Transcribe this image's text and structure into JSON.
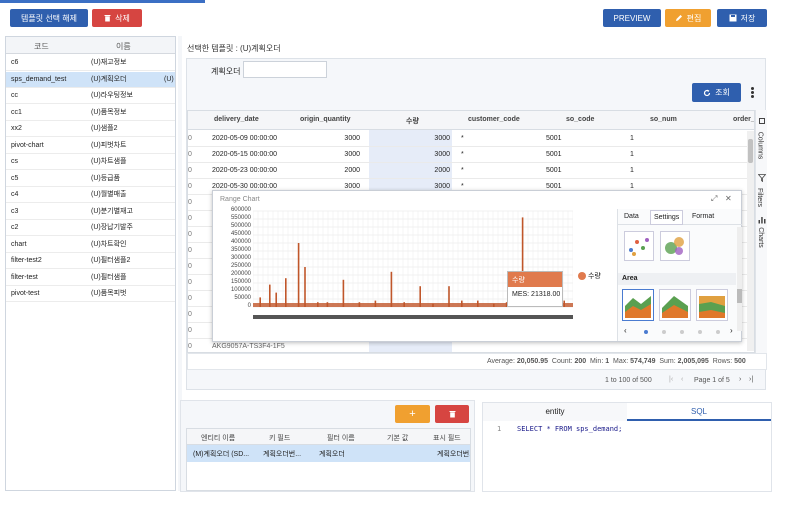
{
  "toolbar": {
    "deselect_label": "템플릿 선택 해제",
    "delete_label": "삭제",
    "preview_label": "PREVIEW",
    "edit_label": "편집",
    "save_label": "저장"
  },
  "colors": {
    "primary": "#2f5fae",
    "danger": "#d64541",
    "warning": "#f0a030",
    "chart_series": "#c0562a",
    "selected_row": "#cfe3f8"
  },
  "template_list": {
    "headers": [
      "코드",
      "이름"
    ],
    "rows": [
      {
        "code": "c6",
        "name": "(U)재고정보"
      },
      {
        "code": "sps_demand_test",
        "name": "(U)계획오더",
        "extra": "(U)"
      },
      {
        "code": "cc",
        "name": "(U)라우팅정보"
      },
      {
        "code": "cc1",
        "name": "(U)품목정보"
      },
      {
        "code": "xx2",
        "name": "(U)샘플2"
      },
      {
        "code": "pivot-chart",
        "name": "(U)피벗차트"
      },
      {
        "code": "cs",
        "name": "(U)차트샘플"
      },
      {
        "code": "c5",
        "name": "(U)등급품"
      },
      {
        "code": "c4",
        "name": "(U)월별매출"
      },
      {
        "code": "c3",
        "name": "(U)분기별재고"
      },
      {
        "code": "c2",
        "name": "(U)장납기발주"
      },
      {
        "code": "chart",
        "name": "(U)차트확인"
      },
      {
        "code": "filter-test2",
        "name": "(U)필터샘플2"
      },
      {
        "code": "filter-test",
        "name": "(U)필터샘플"
      },
      {
        "code": "pivot-test",
        "name": "(U)품목피벗"
      }
    ]
  },
  "main": {
    "selected_template": "선택한 템플릿 : (U)계획오더",
    "filter_label": "계획오더",
    "filter_value": "",
    "search_label": "조회"
  },
  "grid": {
    "headers": [
      "delivery_date",
      "origin_quantity",
      "수량",
      "customer_code",
      "so_code",
      "so_num",
      "order_"
    ],
    "rows": [
      [
        "2020-05-09 00:00:00",
        "3000",
        "3000",
        "*",
        "5001",
        "1"
      ],
      [
        "2020-05-15 00:00:00",
        "3000",
        "3000",
        "*",
        "5001",
        "1"
      ],
      [
        "2020-05-23 00:00:00",
        "2000",
        "2000",
        "*",
        "5001",
        "1"
      ],
      [
        "2020-05-30 00:00:00",
        "3000",
        "3000",
        "*",
        "5001",
        "1"
      ]
    ],
    "partial_row": "AKG9057A-TS3F4-1F5",
    "status": {
      "average_label": "Average:",
      "average": "20,050.95",
      "count_label": "Count:",
      "count": "200",
      "min_label": "Min:",
      "min": "1",
      "max_label": "Max:",
      "max": "574,749",
      "sum_label": "Sum:",
      "sum": "2,005,095",
      "rows_label": "Rows:",
      "rows": "500"
    },
    "pagination": {
      "range": "1 to 100 of 500",
      "page": "Page 1 of 5"
    },
    "side_tabs": [
      "Columns",
      "Filters",
      "Charts"
    ]
  },
  "range_chart": {
    "title": "Range Chart",
    "tooltip_title": "수량",
    "tooltip_value": "MES: 21318.00",
    "settings_tabs": [
      "Data",
      "Settings",
      "Format"
    ],
    "area_label": "Area"
  },
  "chart_data": {
    "type": "bar",
    "title": "",
    "xlabel": "",
    "ylabel": "",
    "ylim": [
      0,
      600000
    ],
    "yticks": [
      0,
      50000,
      100000,
      150000,
      200000,
      250000,
      300000,
      350000,
      400000,
      450000,
      500000,
      550000,
      600000
    ],
    "series": [
      {
        "name": "수량"
      }
    ],
    "spikes": [
      {
        "x": 0.02,
        "value": 60000
      },
      {
        "x": 0.05,
        "value": 140000
      },
      {
        "x": 0.07,
        "value": 90000
      },
      {
        "x": 0.1,
        "value": 180000
      },
      {
        "x": 0.14,
        "value": 400000
      },
      {
        "x": 0.16,
        "value": 250000
      },
      {
        "x": 0.2,
        "value": 30000
      },
      {
        "x": 0.23,
        "value": 30000
      },
      {
        "x": 0.28,
        "value": 170000
      },
      {
        "x": 0.33,
        "value": 30000
      },
      {
        "x": 0.38,
        "value": 40000
      },
      {
        "x": 0.43,
        "value": 220000
      },
      {
        "x": 0.47,
        "value": 30000
      },
      {
        "x": 0.52,
        "value": 130000
      },
      {
        "x": 0.56,
        "value": 20000
      },
      {
        "x": 0.61,
        "value": 130000
      },
      {
        "x": 0.65,
        "value": 40000
      },
      {
        "x": 0.7,
        "value": 40000
      },
      {
        "x": 0.75,
        "value": 20000
      },
      {
        "x": 0.79,
        "value": 30000
      },
      {
        "x": 0.84,
        "value": 560000
      },
      {
        "x": 0.87,
        "value": 60000
      },
      {
        "x": 0.93,
        "value": 80000
      },
      {
        "x": 0.97,
        "value": 40000
      }
    ]
  },
  "entity_panel": {
    "headers": [
      "엔티티 이름",
      "키 필드",
      "필터 이름",
      "기본 값",
      "표시 필드"
    ],
    "row": [
      "(M)계획오더 (SD...",
      "계획오더번...",
      "계획오더",
      "",
      "계획오더번..."
    ]
  },
  "sql_panel": {
    "tabs": [
      "entity",
      "SQL"
    ],
    "line_number": "1",
    "code": "SELECT * FROM sps_demand;"
  }
}
